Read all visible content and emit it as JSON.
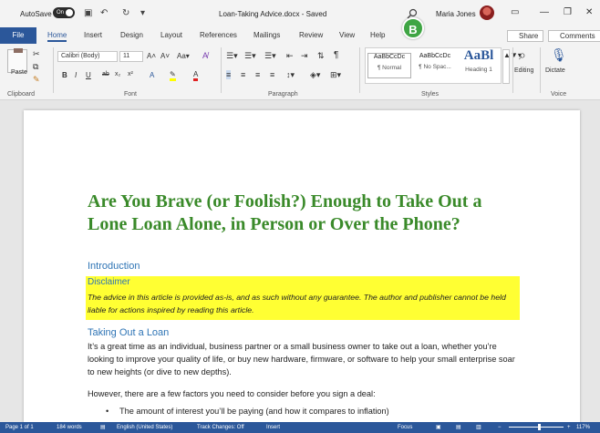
{
  "titlebar": {
    "autosave_label": "AutoSave",
    "autosave_state": "On",
    "doc_title": "Loan-Taking Advice.docx - Saved",
    "user_name": "Maria Jones"
  },
  "tabs": [
    "File",
    "Home",
    "Insert",
    "Design",
    "Layout",
    "References",
    "Mailings",
    "Review",
    "View",
    "Help"
  ],
  "share_label": "Share",
  "comments_label": "Comments",
  "ribbon": {
    "paste_label": "Paste",
    "font_name": "Calibri (Body)",
    "font_size": "11",
    "group_labels": [
      "Clipboard",
      "Font",
      "Paragraph",
      "Styles",
      "Voice"
    ],
    "styles": [
      {
        "sample": "AaBbCcDc",
        "name": "¶ Normal"
      },
      {
        "sample": "AaBbCcDc",
        "name": "¶ No Spac..."
      },
      {
        "sample": "AaBl",
        "name": "Heading 1"
      }
    ],
    "editing_label": "Editing",
    "dictate_label": "Dictate"
  },
  "callout": "B",
  "document": {
    "heading": "Are You Brave (or Foolish?) Enough to Take Out a Lone Loan Alone, in Person or Over the Phone?",
    "intro_heading": "Introduction",
    "disclaimer_title": "Disclaimer",
    "disclaimer_body": "The advice in this article is provided as-is, and as such without any guarantee. The author and publisher cannot be held liable for actions inspired by reading this article.",
    "section_heading": "Taking Out a Loan",
    "paragraph1": "It’s a great time as an individual, business partner or a small business owner to take out a loan, whether you’re looking to improve your quality of life, or buy new  hardware, firmware, or software to help your small enterprise soar to new heights (or dive to new depths).",
    "paragraph2": "However, there are a few factors you need to consider before you sign a deal:",
    "bullet1": "The amount of interest you’ll be paying (and how it compares to inflation)"
  },
  "status": {
    "page": "Page 1 of 1",
    "words": "184 words",
    "language": "English (United States)",
    "track_changes": "Track Changes: Off",
    "mode": "Insert",
    "focus": "Focus",
    "zoom": "117%"
  }
}
